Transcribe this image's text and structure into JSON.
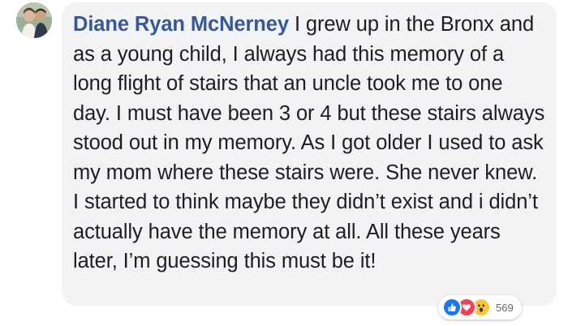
{
  "comment": {
    "author": "Diane Ryan McNerney",
    "text": "I grew up in the Bronx and as a young child, I always had this memory of a long flight of stairs that an uncle took me to one day. I must have been 3 or 4 but these stairs always stood out in my memory. As I got older I used to ask my mom where these stairs were. She never knew. I started to think maybe they didn’t exist and i didn’t actually have the memory at all. All these years later, I’m guessing this must be it!"
  },
  "reactions": {
    "icons": [
      "like-icon",
      "love-icon",
      "wow-icon"
    ],
    "count": "569"
  },
  "colors": {
    "author": "#385898",
    "bubble": "#f2f3f5",
    "text": "#1c1e21",
    "like": "#1877f2",
    "love": "#f33e58",
    "wow": "#fcc43a"
  }
}
